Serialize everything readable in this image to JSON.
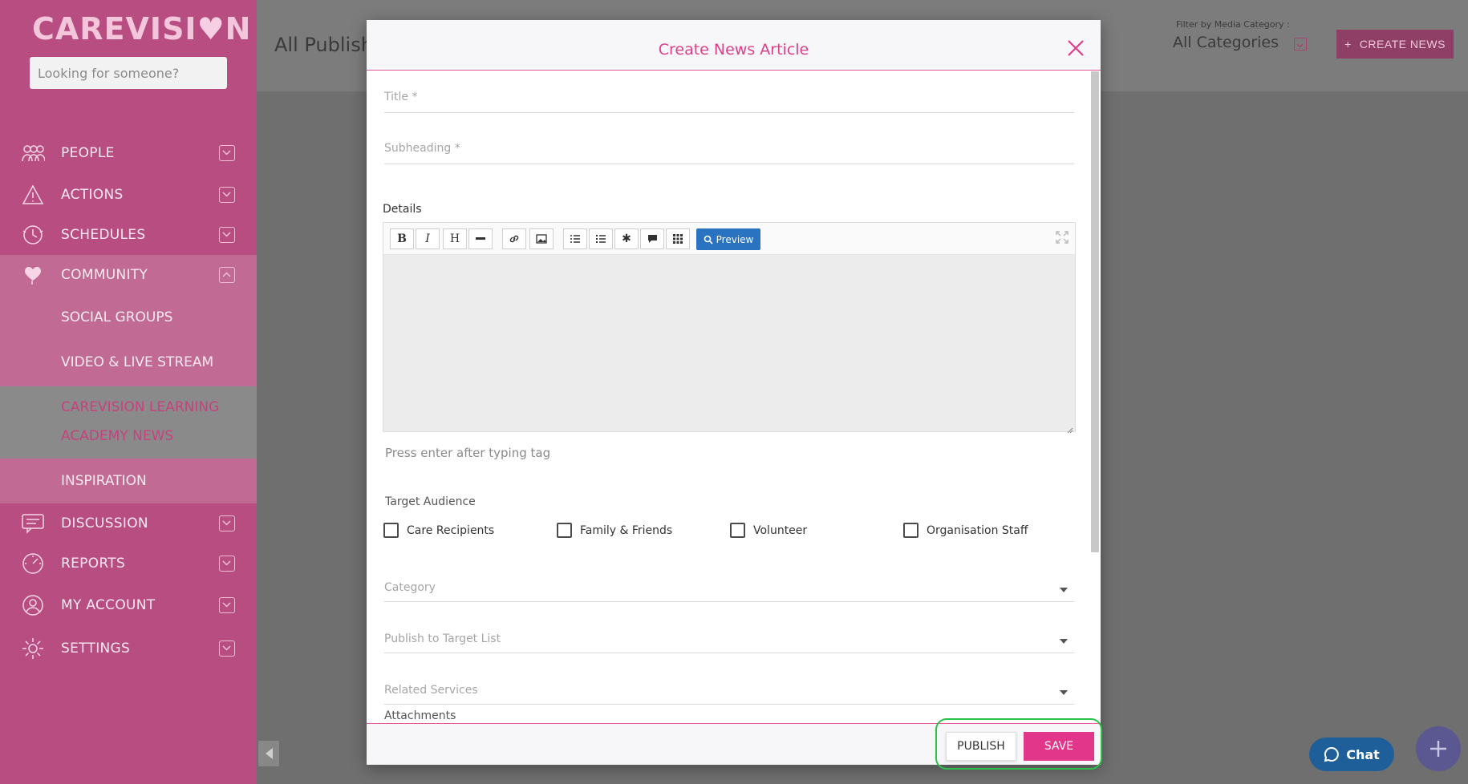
{
  "sidebar": {
    "logo_text": "CAREVISI",
    "logo_heart": "♥",
    "logo_end": "N",
    "search_placeholder": "Looking for someone?",
    "items": [
      {
        "label": "PEOPLE",
        "icon": "people-icon"
      },
      {
        "label": "ACTIONS",
        "icon": "warning-icon"
      },
      {
        "label": "SCHEDULES",
        "icon": "schedule-icon"
      },
      {
        "label": "COMMUNITY",
        "icon": "community-heart-icon"
      },
      {
        "label": "DISCUSSION",
        "icon": "discussion-icon"
      },
      {
        "label": "REPORTS",
        "icon": "reports-icon"
      },
      {
        "label": "MY ACCOUNT",
        "icon": "account-icon"
      },
      {
        "label": "SETTINGS",
        "icon": "settings-icon"
      }
    ],
    "community_sub": [
      "SOCIAL GROUPS",
      "VIDEO & LIVE STREAM",
      "CAREVISION LEARNING",
      "ACADEMY NEWS",
      "INSPIRATION"
    ]
  },
  "header": {
    "title": "All Publish",
    "filter_label": "Filter by Media Category :",
    "filter_value": "All Categories",
    "create_button": "CREATE NEWS",
    "create_plus": "+"
  },
  "modal": {
    "title": "Create News Article",
    "title_placeholder": "Title *",
    "subheading_placeholder": "Subheading *",
    "details_label": "Details",
    "preview_label": "Preview",
    "tag_hint": "Press enter after typing tag",
    "target_audience_label": "Target Audience",
    "audience": [
      "Care Recipients",
      "Family & Friends",
      "Volunteer",
      "Organisation Staff"
    ],
    "category_placeholder": "Category",
    "publish_target_placeholder": "Publish to Target List",
    "related_services_placeholder": "Related Services",
    "attachments_label": "Attachments",
    "publish_button": "PUBLISH",
    "save_button": "SAVE"
  },
  "chat": {
    "label": "Chat"
  },
  "colors": {
    "sidebar": "#b84d82",
    "accent": "#e1368a",
    "preview": "#2a73c0",
    "chat": "#1f5f99"
  }
}
